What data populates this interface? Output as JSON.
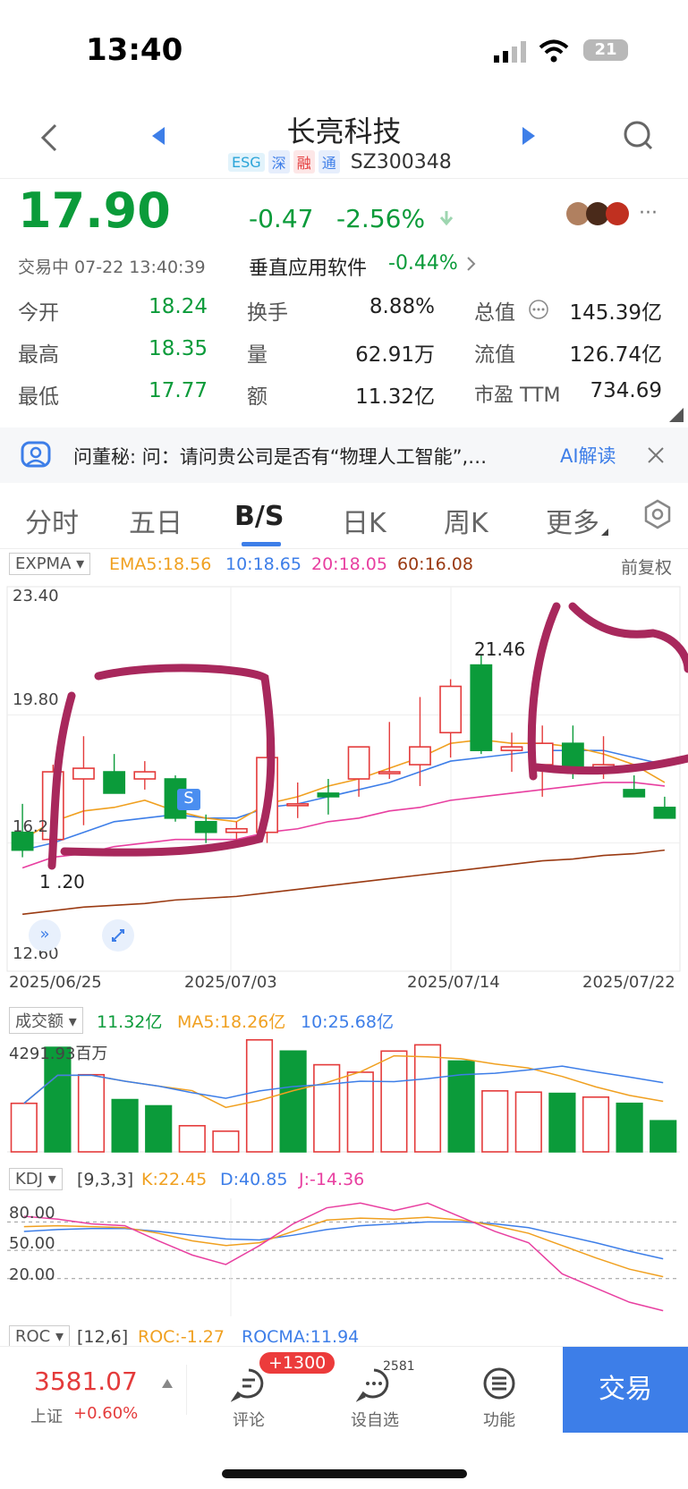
{
  "status": {
    "time": "13:40",
    "battery": "21"
  },
  "header": {
    "title": "长亮科技",
    "tags": [
      "ESG",
      "深",
      "融",
      "通"
    ],
    "code": "SZ300348"
  },
  "quote": {
    "price": "17.90",
    "change": "-0.47",
    "change_pct": "-2.56%",
    "status_time": "交易中 07-22 13:40:39",
    "sector": "垂直应用软件",
    "sector_pct": "-0.44%",
    "stats": [
      {
        "label": "今开",
        "value": "18.24"
      },
      {
        "label": "换手",
        "value": "8.88%"
      },
      {
        "label": "总值",
        "value": "145.39亿"
      },
      {
        "label": "最高",
        "value": "18.35"
      },
      {
        "label": "量",
        "value": "62.91万"
      },
      {
        "label": "流值",
        "value": "126.74亿"
      },
      {
        "label": "最低",
        "value": "17.77"
      },
      {
        "label": "额",
        "value": "11.32亿"
      },
      {
        "label": "市盈 TTM",
        "value": "734.69"
      }
    ]
  },
  "banner": {
    "text": "问董秘: 问：请问贵公司是否有“物理人工智能”,…",
    "ai": "AI解读"
  },
  "tabs": [
    "分时",
    "五日",
    "B/S",
    "日K",
    "周K",
    "更多"
  ],
  "kline": {
    "indicator": "EXPMA",
    "legend": [
      {
        "text": "EMA5:18.56",
        "color": "#f0a020"
      },
      {
        "text": "10:18.65",
        "color": "#3d7ee8"
      },
      {
        "text": "20:18.05",
        "color": "#e83fa0"
      },
      {
        "text": "60:16.08",
        "color": "#9a3a12"
      }
    ],
    "adjust": "前复权",
    "y_labels": [
      "23.40",
      "19.80",
      "16.2",
      "12.60"
    ],
    "x_labels": [
      "2025/06/25",
      "2025/07/03",
      "2025/07/14",
      "2025/07/22"
    ],
    "high_label": "21.46",
    "low_label": "1 .20",
    "marker": "S"
  },
  "volume": {
    "indicator": "成交额",
    "legend": [
      {
        "text": "11.32亿",
        "color": "#0b9b3a"
      },
      {
        "text": "MA5:18.26亿",
        "color": "#f0a020"
      },
      {
        "text": "10:25.68亿",
        "color": "#3d7ee8"
      }
    ],
    "max_label": "4291.93百万"
  },
  "kdj": {
    "indicator": "KDJ",
    "params": "[9,3,3]",
    "legend": [
      {
        "text": "K:22.45",
        "color": "#f0a020"
      },
      {
        "text": "D:40.85",
        "color": "#3d7ee8"
      },
      {
        "text": "J:-14.36",
        "color": "#e83fa0"
      }
    ],
    "levels": [
      "80.00",
      "50.00",
      "20.00"
    ]
  },
  "roc": {
    "indicator": "ROC",
    "params": "[12,6]",
    "legend": [
      {
        "text": "ROC:-1.27",
        "color": "#f0a020"
      },
      {
        "text": "ROCMA:11.94",
        "color": "#3d7ee8"
      }
    ]
  },
  "bottom": {
    "index_value": "3581.07",
    "index_name": "上证",
    "index_pct": "+0.60%",
    "comment_badge": "+1300",
    "comment": "评论",
    "watch_count": "2581",
    "watch": "设自选",
    "func": "功能",
    "trade": "交易"
  },
  "chart_data": {
    "type": "candlestick",
    "candles": [
      {
        "o": 16.5,
        "h": 17.3,
        "l": 15.8,
        "c": 16.0
      },
      {
        "o": 16.3,
        "h": 18.4,
        "l": 15.9,
        "c": 18.2
      },
      {
        "o": 18.0,
        "h": 19.2,
        "l": 16.7,
        "c": 18.3
      },
      {
        "o": 18.2,
        "h": 18.7,
        "l": 17.6,
        "c": 17.6
      },
      {
        "o": 18.0,
        "h": 18.5,
        "l": 17.7,
        "c": 18.2
      },
      {
        "o": 18.0,
        "h": 18.1,
        "l": 16.8,
        "c": 16.9
      },
      {
        "o": 16.8,
        "h": 17.0,
        "l": 16.2,
        "c": 16.5
      },
      {
        "o": 16.5,
        "h": 16.8,
        "l": 16.3,
        "c": 16.6
      },
      {
        "o": 16.5,
        "h": 19.7,
        "l": 16.2,
        "c": 18.6
      },
      {
        "o": 17.3,
        "h": 17.9,
        "l": 16.9,
        "c": 17.3
      },
      {
        "o": 17.6,
        "h": 18.0,
        "l": 17.0,
        "c": 17.5
      },
      {
        "o": 18.0,
        "h": 18.9,
        "l": 17.5,
        "c": 18.9
      },
      {
        "o": 18.2,
        "h": 19.6,
        "l": 18.0,
        "c": 18.2
      },
      {
        "o": 18.4,
        "h": 20.3,
        "l": 17.8,
        "c": 18.9
      },
      {
        "o": 19.3,
        "h": 20.8,
        "l": 18.6,
        "c": 20.6
      },
      {
        "o": 21.2,
        "h": 21.5,
        "l": 18.7,
        "c": 18.8
      },
      {
        "o": 18.8,
        "h": 19.3,
        "l": 18.2,
        "c": 18.9
      },
      {
        "o": 18.4,
        "h": 19.5,
        "l": 17.5,
        "c": 19.0
      },
      {
        "o": 19.0,
        "h": 19.5,
        "l": 18.0,
        "c": 18.2
      },
      {
        "o": 18.2,
        "h": 19.2,
        "l": 18.0,
        "c": 18.4
      },
      {
        "o": 17.7,
        "h": 18.1,
        "l": 17.5,
        "c": 17.5
      },
      {
        "o": 17.2,
        "h": 17.5,
        "l": 16.9,
        "c": 16.9
      }
    ],
    "ema5": [
      16.3,
      16.8,
      17.1,
      17.2,
      17.4,
      17.1,
      16.9,
      16.8,
      17.3,
      17.5,
      17.8,
      18.0,
      18.3,
      18.6,
      19.0,
      19.1,
      19.0,
      19.0,
      18.9,
      18.7,
      18.4,
      17.9
    ],
    "ema10": [
      16.0,
      16.2,
      16.5,
      16.8,
      16.9,
      17.0,
      16.9,
      16.9,
      17.2,
      17.3,
      17.5,
      17.7,
      17.9,
      18.2,
      18.5,
      18.6,
      18.7,
      18.8,
      18.8,
      18.8,
      18.6,
      18.4
    ],
    "ema20": [
      15.5,
      15.8,
      15.9,
      16.1,
      16.2,
      16.3,
      16.3,
      16.3,
      16.5,
      16.6,
      16.8,
      16.9,
      17.1,
      17.2,
      17.4,
      17.5,
      17.6,
      17.7,
      17.8,
      17.9,
      17.9,
      17.8
    ],
    "ema60": [
      14.2,
      14.3,
      14.4,
      14.45,
      14.5,
      14.6,
      14.65,
      14.7,
      14.8,
      14.9,
      15.0,
      15.1,
      15.2,
      15.3,
      15.4,
      15.5,
      15.6,
      15.7,
      15.75,
      15.85,
      15.9,
      16.0
    ],
    "volume_millions": [
      1950,
      4200,
      3100,
      2100,
      1850,
      1050,
      830,
      4500,
      4050,
      3500,
      3200,
      4050,
      4300,
      3650,
      2450,
      2400,
      2350,
      2200,
      1950,
      1250
    ],
    "kdj_k": [
      75,
      76,
      75,
      74,
      68,
      60,
      55,
      58,
      70,
      82,
      84,
      83,
      85,
      82,
      76,
      68,
      55,
      42,
      30,
      22
    ],
    "kdj_d": [
      70,
      72,
      73,
      73,
      70,
      66,
      62,
      61,
      66,
      72,
      76,
      78,
      80,
      80,
      78,
      74,
      66,
      58,
      49,
      41
    ],
    "kdj_j": [
      86,
      83,
      78,
      76,
      60,
      45,
      35,
      55,
      78,
      95,
      100,
      92,
      100,
      85,
      70,
      58,
      25,
      10,
      -5,
      -14
    ],
    "ylim": [
      12.6,
      23.4
    ]
  }
}
